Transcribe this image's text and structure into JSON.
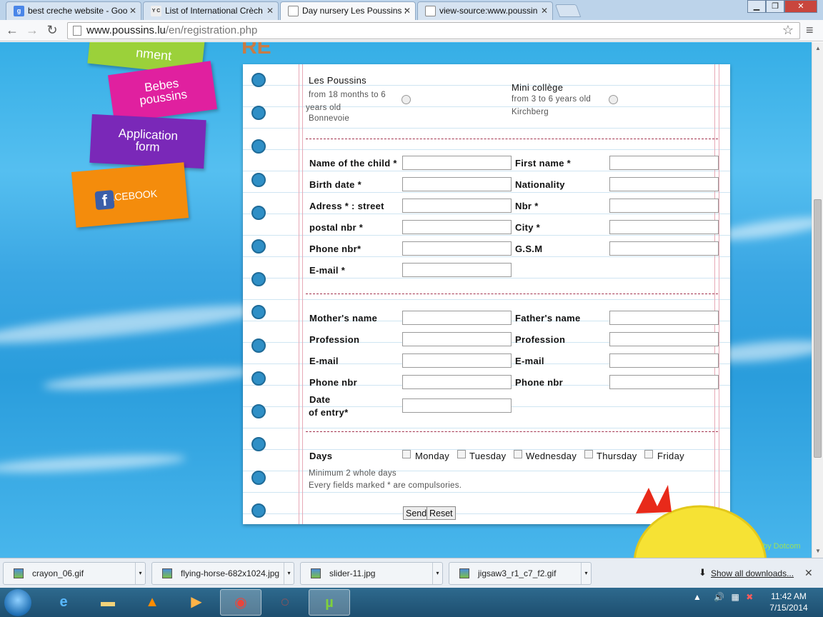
{
  "browser": {
    "tabs": [
      {
        "label": "best creche website - Goo",
        "icon": "google-icon",
        "active": false
      },
      {
        "label": "List of International Crèch",
        "icon": "yc-icon",
        "active": false
      },
      {
        "label": "Day nursery Les Poussins :",
        "icon": "page-icon",
        "active": true
      },
      {
        "label": "view-source:www.poussin",
        "icon": "page-icon",
        "active": false
      }
    ],
    "url_host": "www.poussins.lu",
    "url_path": "/en/registration.php"
  },
  "side_tags": {
    "top_partial": "nment",
    "bebes": "Bebes poussins",
    "application": "Application form",
    "facebook": "FACEBOOK"
  },
  "form": {
    "nurseries": [
      {
        "name": "Les Poussins",
        "desc": "from 18 months to 6 years old",
        "location": "Bonnevoie"
      },
      {
        "name": "Mini collège",
        "desc": "from 3 to 6 years old",
        "location": "Kirchberg"
      }
    ],
    "child": {
      "name_of_child": "Name of the child *",
      "first_name": "First name *",
      "birth_date": "Birth date *",
      "nationality": "Nationality",
      "street": "Adress * : street",
      "nbr": "Nbr *",
      "postal": "postal nbr *",
      "city": "City *",
      "phone": "Phone nbr*",
      "gsm": "G.S.M",
      "email": "E-mail *"
    },
    "parents": {
      "mother_name": "Mother's name",
      "father_name": "Father's name",
      "profession_m": "Profession",
      "profession_f": "Profession",
      "email_m": "E-mail",
      "email_f": "E-mail",
      "phone_m": "Phone nbr",
      "phone_f": "Phone nbr",
      "date_entry_1": "Date",
      "date_entry_2": "of entry*"
    },
    "days": {
      "label": "Days",
      "options": [
        "Monday",
        "Tuesday",
        "Wednesday",
        "Thursday",
        "Friday"
      ],
      "note1": "Minimum 2 whole days",
      "note2": "Every fields marked * are compulsories."
    },
    "send_label": "Send",
    "reset_label": "Reset"
  },
  "credit": "by Dotcom",
  "downloads": {
    "items": [
      "crayon_06.gif",
      "flying-horse-682x1024.jpg",
      "slider-11.jpg",
      "jigsaw3_r1_c7_f2.gif"
    ],
    "show_all": "Show all downloads..."
  },
  "taskbar": {
    "time": "11:42 AM",
    "date": "7/15/2014"
  }
}
